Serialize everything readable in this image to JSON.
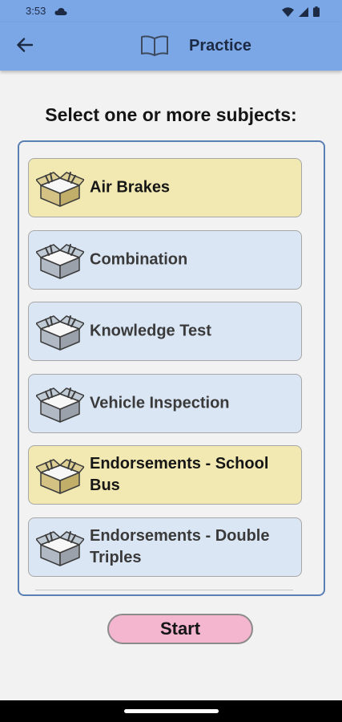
{
  "status_bar": {
    "time": "3:53",
    "icons": [
      "cloud-icon",
      "wifi-icon",
      "signal-icon",
      "battery-icon"
    ]
  },
  "app_bar": {
    "title": "Practice",
    "back_icon": "arrow-left-icon",
    "title_icon": "open-book-icon"
  },
  "heading": "Select one or more subjects:",
  "subjects": [
    {
      "label": "Air Brakes",
      "selected": true
    },
    {
      "label": "Combination",
      "selected": false
    },
    {
      "label": "Knowledge Test",
      "selected": false
    },
    {
      "label": "Vehicle Inspection",
      "selected": false
    },
    {
      "label": "Endorsements - School Bus",
      "selected": true
    },
    {
      "label": "Endorsements - Double Triples",
      "selected": false
    }
  ],
  "start_button": {
    "label": "Start"
  },
  "colors": {
    "app_bar": "#7ba7e6",
    "selected_item": "#f2e9b2",
    "unselected_item": "#dbe6f4",
    "list_border": "#5a7fb3",
    "start_button": "#f4b6cf"
  }
}
